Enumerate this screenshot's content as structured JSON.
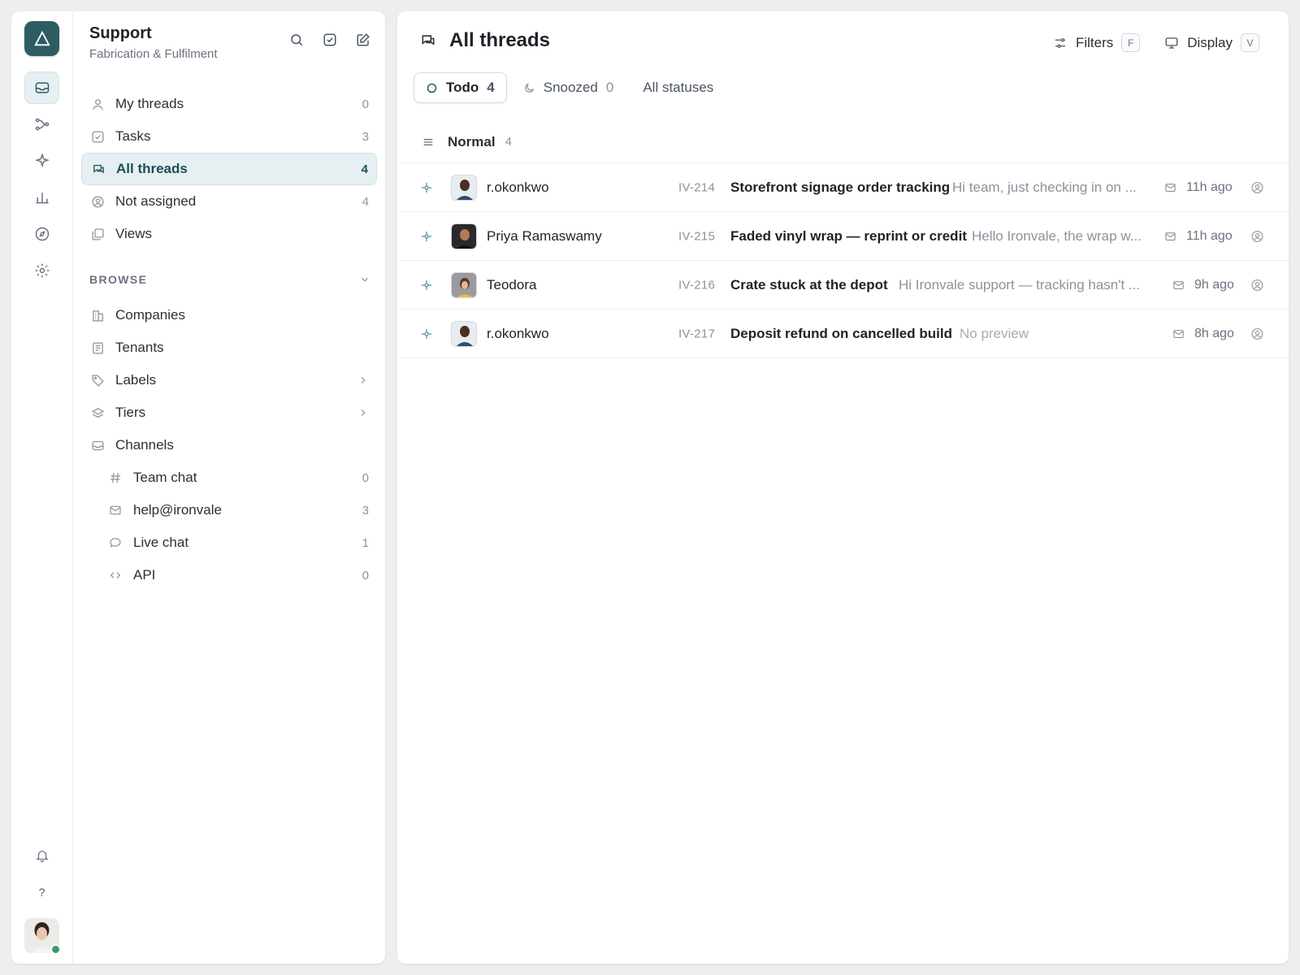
{
  "workspace": {
    "title": "Support",
    "subtitle": "Fabrication & Fulfilment"
  },
  "nav": [
    {
      "label": "My threads",
      "count": "0",
      "icon": "user-icon"
    },
    {
      "label": "Tasks",
      "count": "3",
      "icon": "checkbox-icon"
    },
    {
      "label": "All threads",
      "count": "4",
      "icon": "chat-icon",
      "active": true
    },
    {
      "label": "Not assigned",
      "count": "4",
      "icon": "user-circle-icon"
    },
    {
      "label": "Views",
      "count": "",
      "icon": "views-icon"
    }
  ],
  "browse": {
    "label": "BROWSE",
    "items": [
      {
        "label": "Companies",
        "icon": "building-icon"
      },
      {
        "label": "Tenants",
        "icon": "list-icon"
      },
      {
        "label": "Labels",
        "icon": "tag-icon"
      },
      {
        "label": "Tiers",
        "icon": "layers-icon"
      },
      {
        "label": "Channels",
        "icon": "inbox-icon"
      }
    ],
    "channels": [
      {
        "label": "Team chat",
        "count": "0",
        "icon": "hash-icon"
      },
      {
        "label": "help@ironvale",
        "count": "3",
        "icon": "mail-icon"
      },
      {
        "label": "Live chat",
        "count": "1",
        "icon": "speech-bubble-icon"
      },
      {
        "label": "API",
        "count": "0",
        "icon": "code-icon"
      }
    ]
  },
  "main": {
    "title": "All threads",
    "filters_label": "Filters",
    "filters_key": "F",
    "display_label": "Display",
    "display_key": "V",
    "tabs": [
      {
        "label": "Todo",
        "count": "4"
      },
      {
        "label": "Snoozed",
        "count": "0"
      },
      {
        "label": "All statuses",
        "count": ""
      }
    ],
    "group": {
      "label": "Normal",
      "count": "4"
    },
    "threads": [
      {
        "name": "r.okonkwo",
        "id": "IV-214",
        "subject": "Storefront signage order tracking",
        "preview": "Hi team, just checking in on ...",
        "time": "11h ago"
      },
      {
        "name": "Priya Ramaswamy",
        "id": "IV-215",
        "subject": "Faded vinyl wrap — reprint or credit",
        "preview": "Hello Ironvale, the wrap w...",
        "time": "11h ago"
      },
      {
        "name": "Teodora",
        "id": "IV-216",
        "subject": "Crate stuck at the depot",
        "preview": "Hi Ironvale support — tracking hasn't ...",
        "time": "9h ago"
      },
      {
        "name": "r.okonkwo",
        "id": "IV-217",
        "subject": "Deposit refund on cancelled build",
        "preview": "No preview",
        "time": "8h ago"
      }
    ]
  },
  "colors": {
    "accent": "#2d5c63",
    "active_bg": "#e6f0f3",
    "online": "#3a9a6b"
  }
}
